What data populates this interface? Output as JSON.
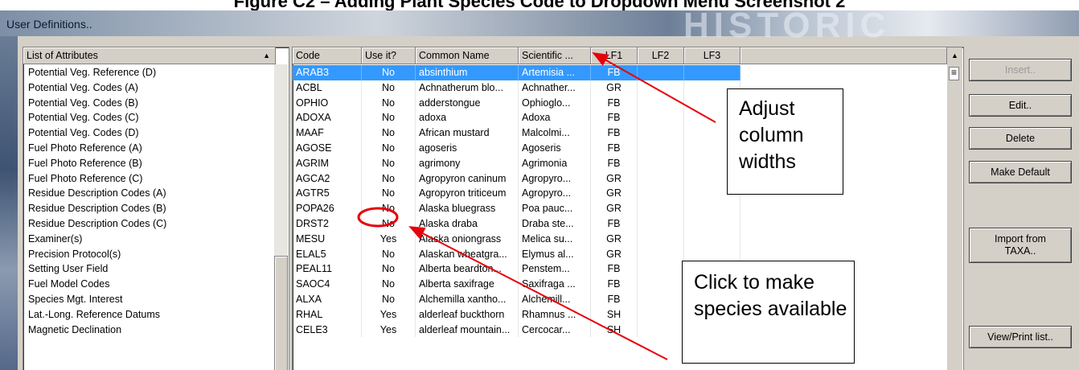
{
  "figure_title": "Figure C2 – Adding Plant Species Code to Dropdown Menu Screenshot 2",
  "window": {
    "title": "User Definitions..",
    "watermark": "HISTORIC"
  },
  "attributes_list": {
    "header": "List of Attributes",
    "items": [
      "Potential Veg. Reference (D)",
      "Potential Veg. Codes (A)",
      "Potential Veg. Codes (B)",
      "Potential Veg. Codes (C)",
      "Potential Veg. Codes (D)",
      "Fuel Photo Reference (A)",
      "Fuel Photo Reference (B)",
      "Fuel Photo Reference (C)",
      "Residue Description Codes (A)",
      "Residue Description Codes (B)",
      "Residue Description Codes (C)",
      "Examiner(s)",
      "Precision Protocol(s)",
      "Setting User Field",
      "Fuel Model Codes",
      "Species Mgt. Interest",
      "Lat.-Long. Reference Datums",
      "Magnetic Declination"
    ]
  },
  "species_table": {
    "columns": [
      "Code",
      "Use it?",
      "Common Name",
      "Scientific ...",
      "LF1",
      "LF2",
      "LF3"
    ],
    "rows": [
      {
        "code": "ARAB3",
        "use": "No",
        "common": "absinthium",
        "scientific": "Artemisia ...",
        "lf1": "FB",
        "selected": true
      },
      {
        "code": "ACBL",
        "use": "No",
        "common": "Achnatherum blo...",
        "scientific": "Achnather...",
        "lf1": "GR"
      },
      {
        "code": "OPHIO",
        "use": "No",
        "common": "adderstongue",
        "scientific": "Ophioglo...",
        "lf1": "FB"
      },
      {
        "code": "ADOXA",
        "use": "No",
        "common": "adoxa",
        "scientific": "Adoxa",
        "lf1": "FB"
      },
      {
        "code": "MAAF",
        "use": "No",
        "common": "African mustard",
        "scientific": "Malcolmi...",
        "lf1": "FB"
      },
      {
        "code": "AGOSE",
        "use": "No",
        "common": "agoseris",
        "scientific": "Agoseris",
        "lf1": "FB"
      },
      {
        "code": "AGRIM",
        "use": "No",
        "common": "agrimony",
        "scientific": "Agrimonia",
        "lf1": "FB"
      },
      {
        "code": "AGCA2",
        "use": "No",
        "common": "Agropyron caninum",
        "scientific": "Agropyro...",
        "lf1": "GR"
      },
      {
        "code": "AGTR5",
        "use": "No",
        "common": "Agropyron triticeum",
        "scientific": "Agropyro...",
        "lf1": "GR"
      },
      {
        "code": "POPA26",
        "use": "No",
        "common": "Alaska bluegrass",
        "scientific": "Poa pauc...",
        "lf1": "GR"
      },
      {
        "code": "DRST2",
        "use": "No",
        "common": "Alaska draba",
        "scientific": "Draba ste...",
        "lf1": "FB"
      },
      {
        "code": "MESU",
        "use": "Yes",
        "common": "Alaska oniongrass",
        "scientific": "Melica su...",
        "lf1": "GR"
      },
      {
        "code": "ELAL5",
        "use": "No",
        "common": "Alaskan wheatgra...",
        "scientific": "Elymus al...",
        "lf1": "GR"
      },
      {
        "code": "PEAL11",
        "use": "No",
        "common": "Alberta beardton...",
        "scientific": "Penstem...",
        "lf1": "FB"
      },
      {
        "code": "SAOC4",
        "use": "No",
        "common": "Alberta saxifrage",
        "scientific": "Saxifraga ...",
        "lf1": "FB"
      },
      {
        "code": "ALXA",
        "use": "No",
        "common": "Alchemilla xantho...",
        "scientific": "Alchemill...",
        "lf1": "FB"
      },
      {
        "code": "RHAL",
        "use": "Yes",
        "common": "alderleaf buckthorn",
        "scientific": "Rhamnus ...",
        "lf1": "SH"
      },
      {
        "code": "CELE3",
        "use": "Yes",
        "common": "alderleaf mountain...",
        "scientific": "Cercocar...",
        "lf1": "SH"
      }
    ]
  },
  "buttons": {
    "insert": "Insert..",
    "edit": "Edit..",
    "delete": "Delete",
    "make_default": "Make Default",
    "import": "Import from TAXA..",
    "view_print": "View/Print list.."
  },
  "callouts": {
    "adjust": "Adjust column widths",
    "click": "Click to make species available"
  },
  "colors": {
    "selection": "#3399ff",
    "annotation": "#e8000b",
    "dialog_face": "#d4d0c8"
  }
}
